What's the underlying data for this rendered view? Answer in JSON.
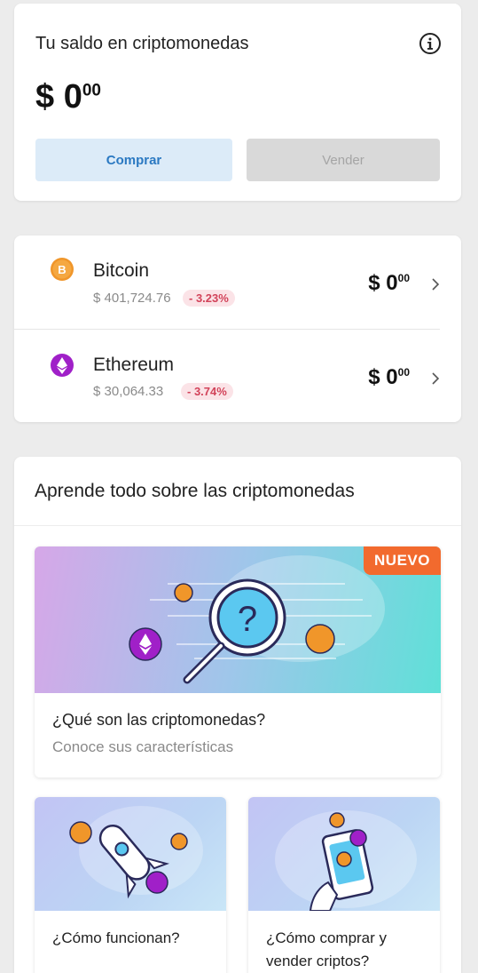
{
  "balance": {
    "title": "Tu saldo en criptomonedas",
    "currency": "$",
    "integer": "0",
    "cents": "00",
    "buy_label": "Comprar",
    "sell_label": "Vender",
    "info_icon": "info-icon"
  },
  "coins": [
    {
      "name": "Bitcoin",
      "price": "$ 401,724.76",
      "change": "- 3.23%",
      "amount_currency": "$",
      "amount_integer": "0",
      "amount_cents": "00",
      "icon": "bitcoin-icon",
      "color": "#f0962a"
    },
    {
      "name": "Ethereum",
      "price": "$ 30,064.33",
      "change": "- 3.74%",
      "amount_currency": "$",
      "amount_integer": "0",
      "amount_cents": "00",
      "icon": "ethereum-icon",
      "color": "#a020c8"
    }
  ],
  "learn": {
    "title": "Aprende todo sobre las criptomonedas",
    "featured": {
      "badge": "NUEVO",
      "title": "¿Qué son las criptomonedas?",
      "subtitle": "Conoce sus características"
    },
    "cards": [
      {
        "title": "¿Cómo funcionan?"
      },
      {
        "title": "¿Cómo comprar y vender criptos?"
      }
    ]
  },
  "colors": {
    "accent_blue": "#2b79c2",
    "negative_red": "#d2435a",
    "badge_orange": "#f26a2e"
  }
}
